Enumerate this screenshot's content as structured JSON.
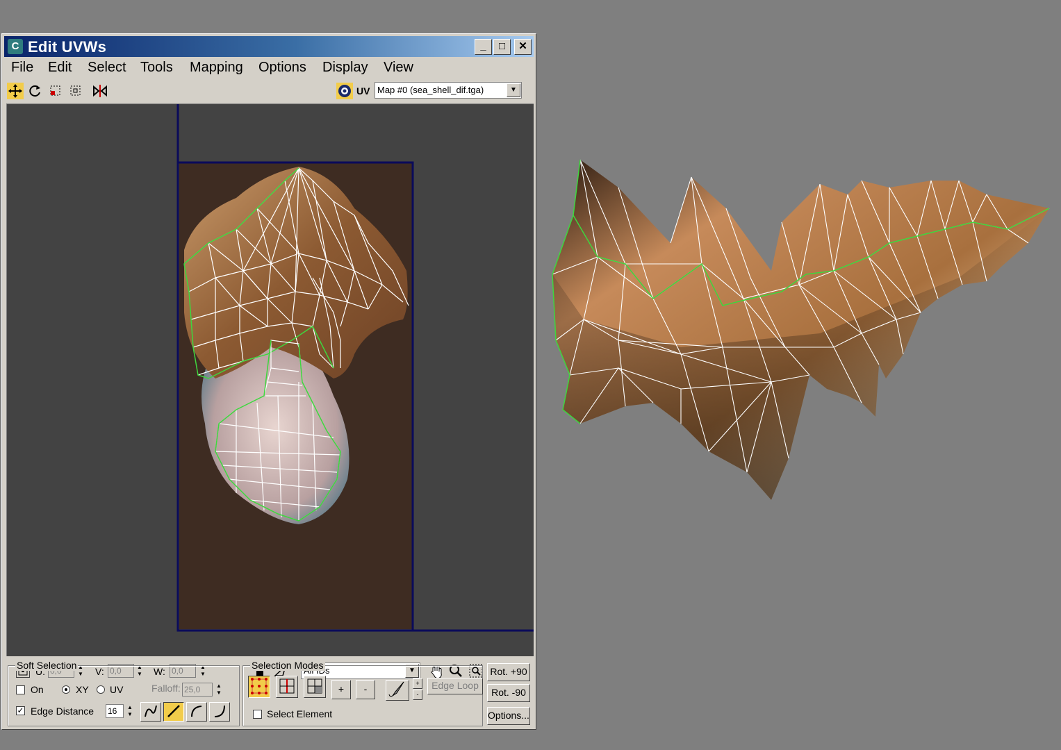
{
  "window": {
    "title": "Edit UVWs",
    "icon": "max-app-icon",
    "caption_buttons": [
      "minimize",
      "maximize",
      "close"
    ]
  },
  "menu": [
    "File",
    "Edit",
    "Select",
    "Tools",
    "Mapping",
    "Options",
    "Display",
    "View"
  ],
  "toolbar": {
    "tools": [
      "move-icon",
      "rotate-icon",
      "scale-icon",
      "freeform-icon",
      "mirror-icon"
    ],
    "uv_label": "UV",
    "map_select": "Map #0 (sea_shell_dif.tga)"
  },
  "coords": {
    "u_label": "U:",
    "u_value": "0,0",
    "v_label": "V:",
    "v_value": "0,0",
    "w_label": "W:",
    "w_value": "0,0",
    "ids_select": "All IDs"
  },
  "soft_selection": {
    "title": "Soft Selection",
    "on_label": "On",
    "xy_label": "XY",
    "uv_label": "UV",
    "falloff_label": "Falloff:",
    "falloff_value": "25,0",
    "edge_distance_label": "Edge Distance",
    "edge_distance_value": "16"
  },
  "selection_modes": {
    "title": "Selection Modes",
    "plus": "+",
    "minus": "-",
    "edge_loop": "Edge Loop",
    "select_element": "Select Element"
  },
  "side_buttons": {
    "rot_plus": "Rot. +90",
    "rot_minus": "Rot. -90",
    "options": "Options..."
  },
  "colors": {
    "desktop": "#7f7f7f",
    "window": "#d4d0c8",
    "viewport": "#434343",
    "texture_bg": "#3e2c22",
    "uv_bounds": "#0a0a5a",
    "seam": "#3ed63e",
    "wire": "#ffffff",
    "active_button": "#f2cc4a"
  }
}
